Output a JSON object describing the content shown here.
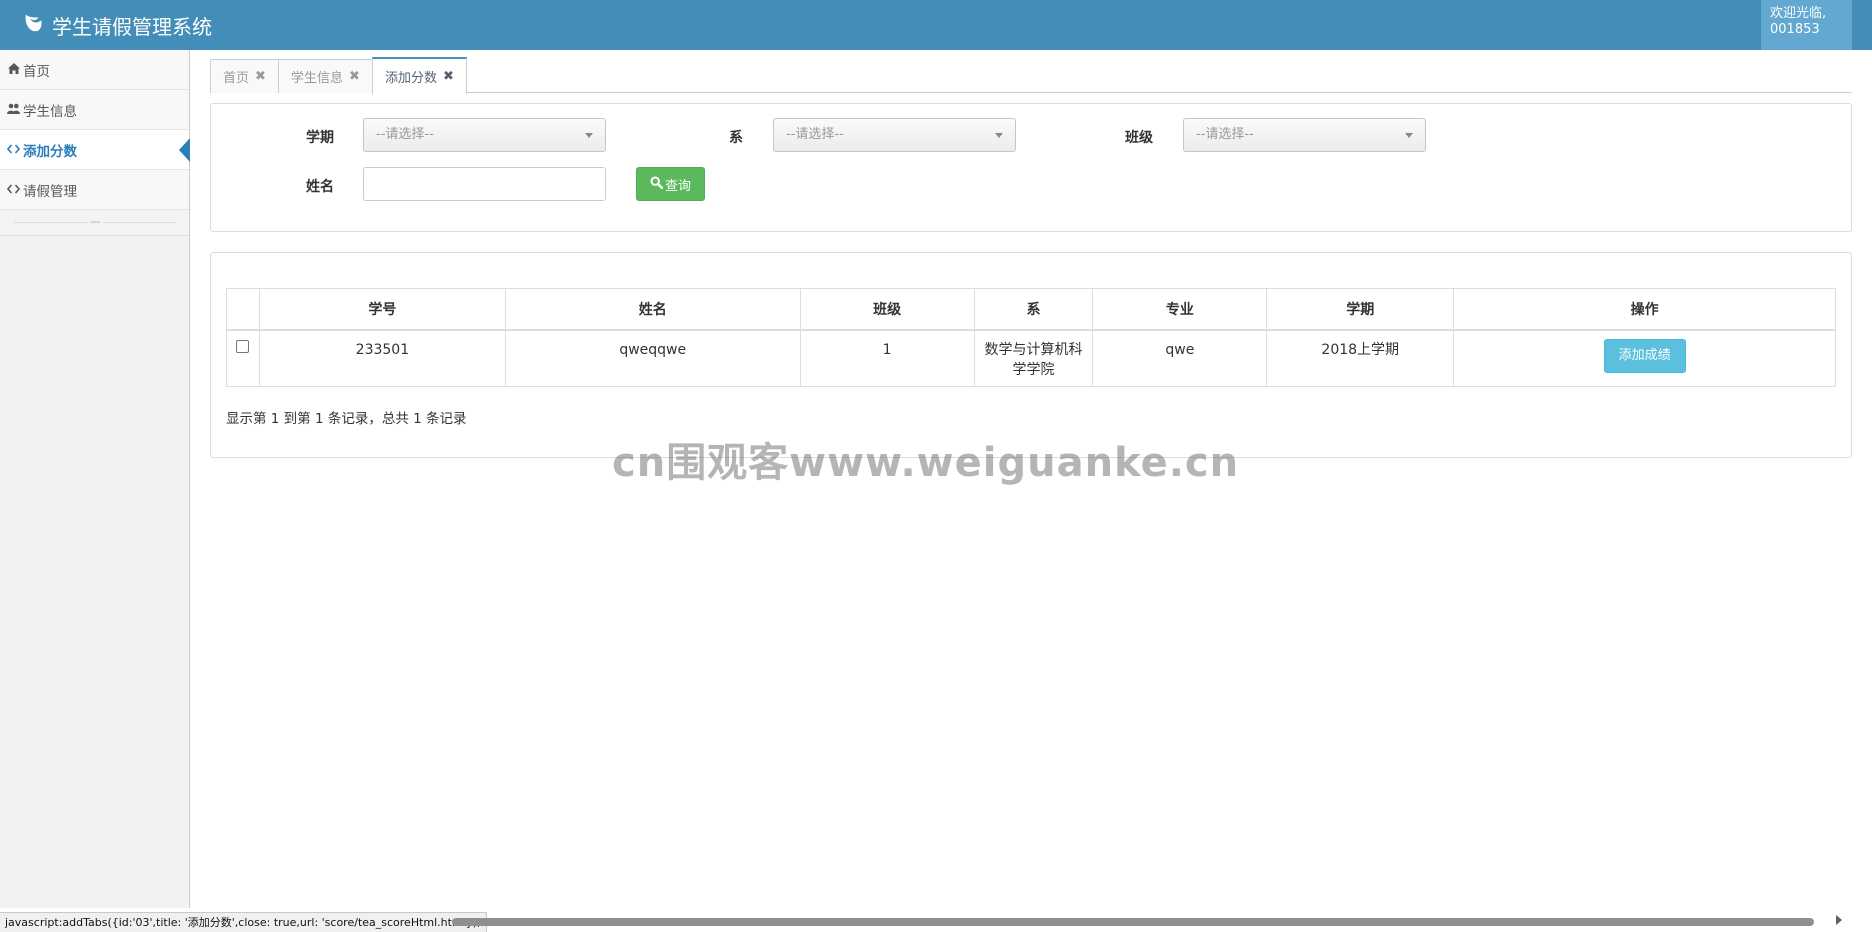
{
  "header": {
    "title": "学生请假管理系统",
    "welcome": "欢迎光临,",
    "user_id": "001853"
  },
  "sidebar": {
    "items": [
      {
        "label": "首页",
        "icon": "home-icon"
      },
      {
        "label": "学生信息",
        "icon": "users-icon"
      },
      {
        "label": "添加分数",
        "icon": "code-icon",
        "active": true
      },
      {
        "label": "请假管理",
        "icon": "code-icon"
      }
    ]
  },
  "tabs": [
    {
      "label": "首页"
    },
    {
      "label": "学生信息"
    },
    {
      "label": "添加分数",
      "active": true
    }
  ],
  "filters": {
    "term_label": "学期",
    "dept_label": "系",
    "class_label": "班级",
    "name_label": "姓名",
    "select_placeholder": "--请选择--",
    "search_button": "查询"
  },
  "table": {
    "headers": [
      "学号",
      "姓名",
      "班级",
      "系",
      "专业",
      "学期",
      "操作"
    ],
    "rows": [
      {
        "id": "233501",
        "name": "qweqqwe",
        "class": "1",
        "dept_line1": "数学与计算机科",
        "dept_line2": "学学院",
        "major": "qwe",
        "term": "2018上学期",
        "action": "添加成绩"
      }
    ],
    "pager_info": "显示第 1 到第 1 条记录，总共 1 条记录"
  },
  "watermark": "cn围观客www.weiguanke.cn",
  "status_bar": "javascript:addTabs({id:'03',title: '添加分数',close: true,url: 'score/tea_scoreHtml.htm'});",
  "colors": {
    "header_bg": "#438eb9",
    "user_box_bg": "#62a8d1",
    "active_nav": "#2b7dbc",
    "search_button": "#5cb85c",
    "add_button": "#5bc0de"
  }
}
